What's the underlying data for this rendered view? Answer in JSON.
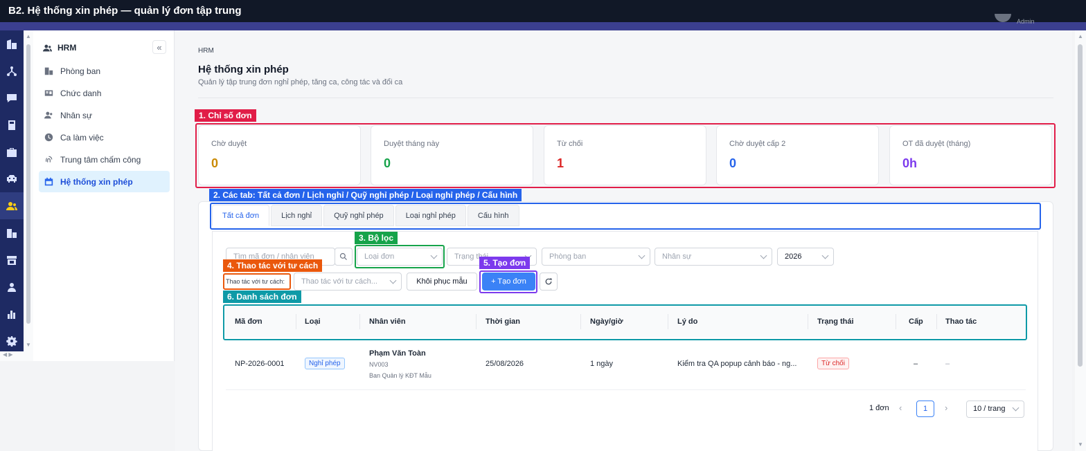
{
  "window_title": "B2. Hệ thống xin phép — quản lý đơn tập trung",
  "user": {
    "name": "Admin"
  },
  "sidebar": {
    "module": "HRM",
    "collapse_icon": "«",
    "items": [
      {
        "label": "Phòng ban",
        "icon": "department-icon"
      },
      {
        "label": "Chức danh",
        "icon": "id-card-icon"
      },
      {
        "label": "Nhân sự",
        "icon": "users-icon"
      },
      {
        "label": "Ca làm việc",
        "icon": "clock-icon"
      },
      {
        "label": "Trung tâm chấm công",
        "icon": "fingerprint-icon"
      },
      {
        "label": "Hệ thống xin phép",
        "icon": "calendar-icon",
        "active": true
      }
    ]
  },
  "page": {
    "breadcrumb": "HRM",
    "title": "Hệ thống xin phép",
    "subtitle": "Quản lý tập trung đơn nghỉ phép, tăng ca, công tác và đổi ca"
  },
  "annotations": {
    "stats": "1. Chỉ số đơn",
    "tabs": "2. Các tab: Tất cả đơn / Lịch nghỉ / Quỹ nghỉ phép / Loại nghỉ phép / Cấu hình",
    "filters": "3. Bộ lọc",
    "act_as": "4. Thao tác với tư cách",
    "create": "5. Tạo đơn",
    "list": "6. Danh sách đơn"
  },
  "stats": [
    {
      "label": "Chờ duyệt",
      "value": "0",
      "color": "#ca8a04"
    },
    {
      "label": "Duyệt tháng này",
      "value": "0",
      "color": "#16a34a"
    },
    {
      "label": "Từ chối",
      "value": "1",
      "color": "#dc2626"
    },
    {
      "label": "Chờ duyệt cấp 2",
      "value": "0",
      "color": "#2563eb"
    },
    {
      "label": "OT đã duyệt (tháng)",
      "value": "0h",
      "color": "#7c3aed"
    }
  ],
  "tabs": [
    "Tất cả đơn",
    "Lịch nghỉ",
    "Quỹ nghỉ phép",
    "Loại nghỉ phép",
    "Cấu hình"
  ],
  "filters": {
    "search_placeholder": "Tìm mã đơn / nhân viên",
    "type_placeholder": "Loại đơn",
    "status_placeholder": "Trạng thái",
    "department_placeholder": "Phòng ban",
    "employee_placeholder": "Nhân sự",
    "year": "2026",
    "act_as_label": "Thao tác với tư cách:",
    "act_as_placeholder": "Thao tác với tư cách...",
    "restore_label": "Khôi phục mẫu",
    "create_label": "+ Tạo đơn"
  },
  "table": {
    "headers": [
      "Mã đơn",
      "Loại",
      "Nhân viên",
      "Thời gian",
      "Ngày/giờ",
      "Lý do",
      "Trạng thái",
      "Cấp",
      "Thao tác"
    ],
    "rows": [
      {
        "code": "NP-2026-0001",
        "type": "Nghỉ phép",
        "employee_name": "Phạm Văn Toàn",
        "employee_id": "NV003",
        "employee_dept": "Ban Quản lý KĐT Mẫu",
        "time": "25/08/2026",
        "duration": "1 ngày",
        "reason": "Kiểm tra QA popup cảnh báo - ng...",
        "status": "Từ chối",
        "level": "–",
        "actions": "–"
      }
    ]
  },
  "pagination": {
    "total": "1 đơn",
    "current": "1",
    "page_size": "10 / trang"
  },
  "colors": {
    "ann_red": "#e11d48",
    "ann_blue": "#2563eb",
    "ann_green": "#16a34a",
    "ann_orange": "#ea580c",
    "ann_purple": "#7c3aed",
    "ann_teal": "#0e9aa7"
  }
}
